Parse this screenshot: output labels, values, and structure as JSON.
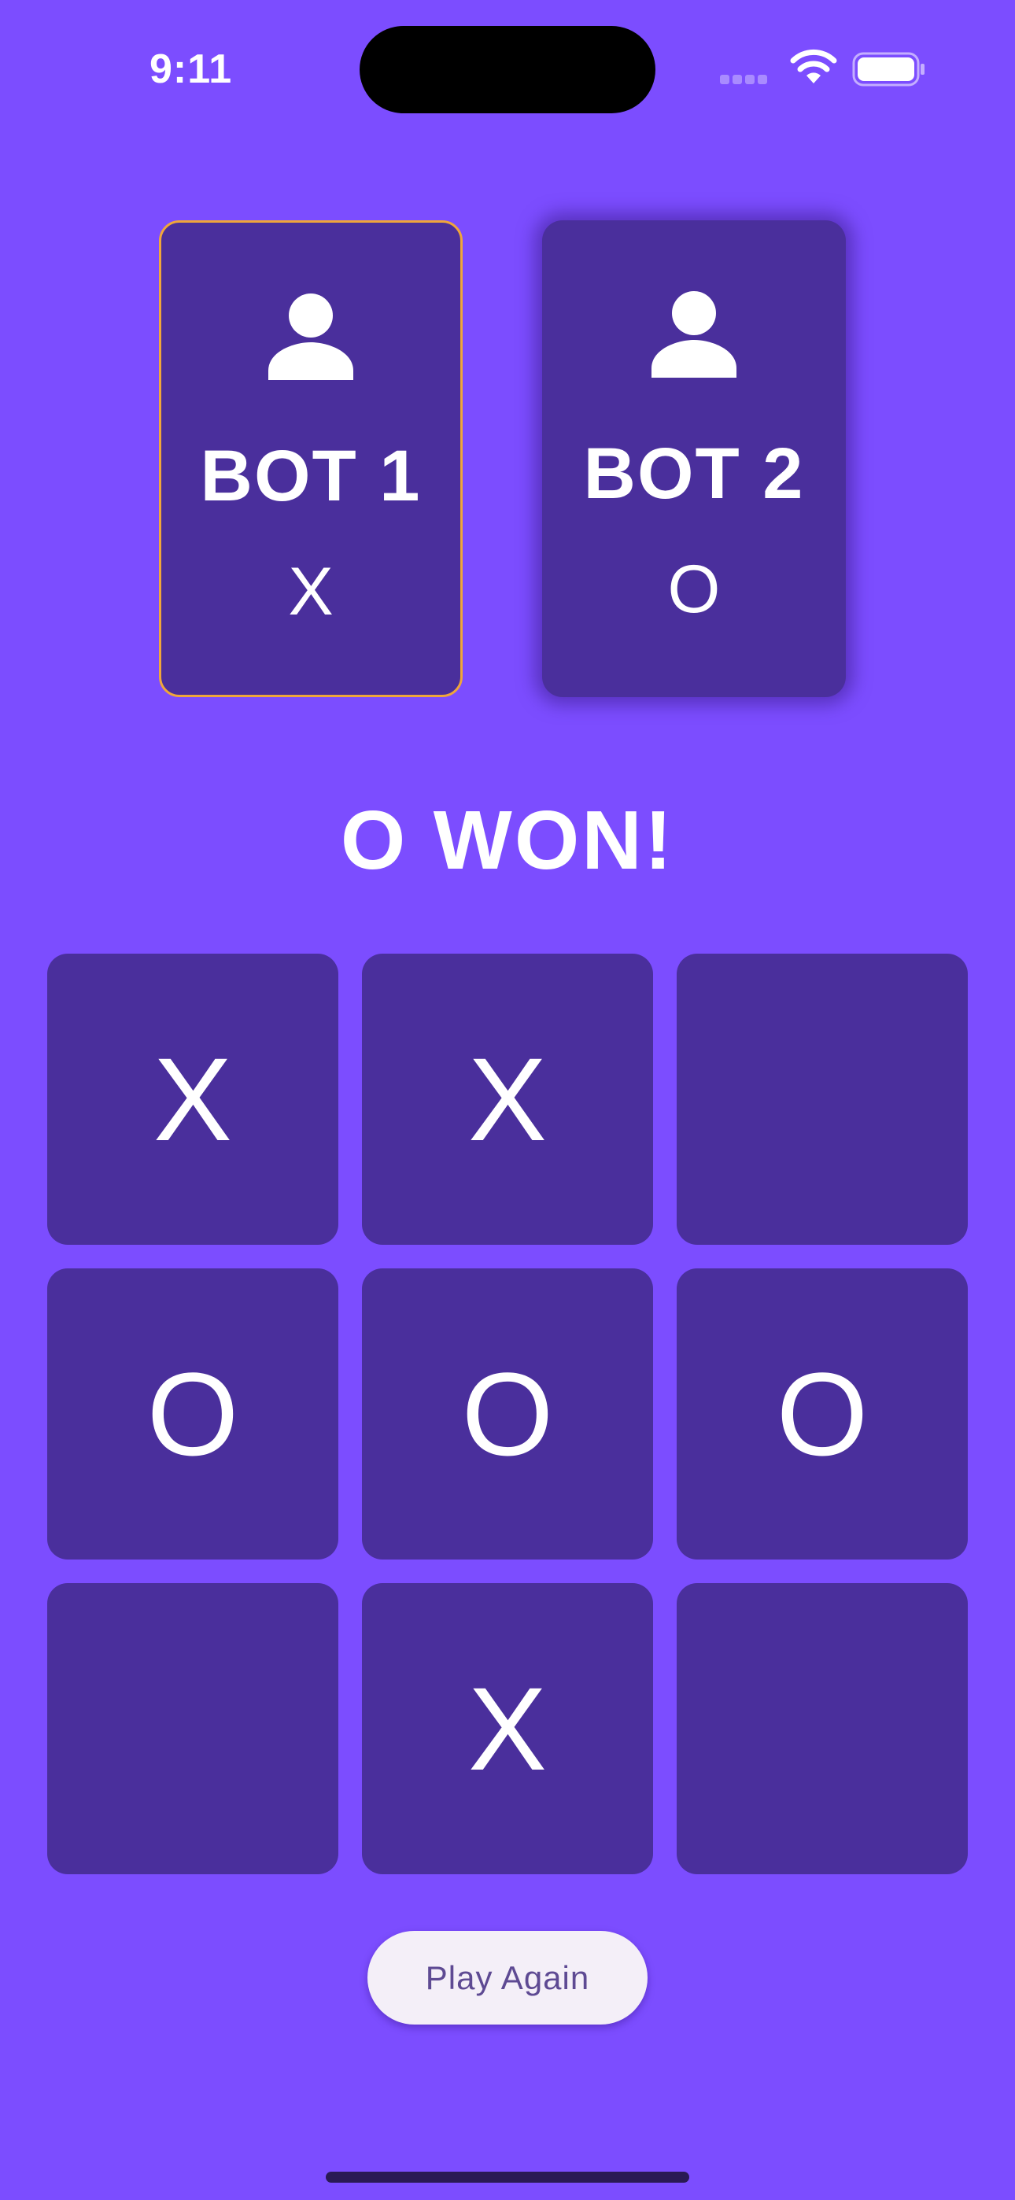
{
  "status_bar": {
    "time": "9:11"
  },
  "players": [
    {
      "name": "BOT 1",
      "symbol": "X",
      "active": true
    },
    {
      "name": "BOT 2",
      "symbol": "O",
      "active": false
    }
  ],
  "game_status": "O WON!",
  "board": {
    "cells": [
      "X",
      "X",
      "",
      "O",
      "O",
      "O",
      "",
      "X",
      ""
    ]
  },
  "actions": {
    "play_again_label": "Play Again"
  },
  "colors": {
    "background": "#7c4dff",
    "card": "#4a2f9c",
    "active_border": "#f0a63a",
    "button_bg": "#f4eff8",
    "button_text": "#5e4a93"
  },
  "icons": {
    "player_avatar": "person-icon",
    "wifi": "wifi-icon",
    "battery": "battery-icon",
    "signal": "cellular-signal-icon"
  }
}
